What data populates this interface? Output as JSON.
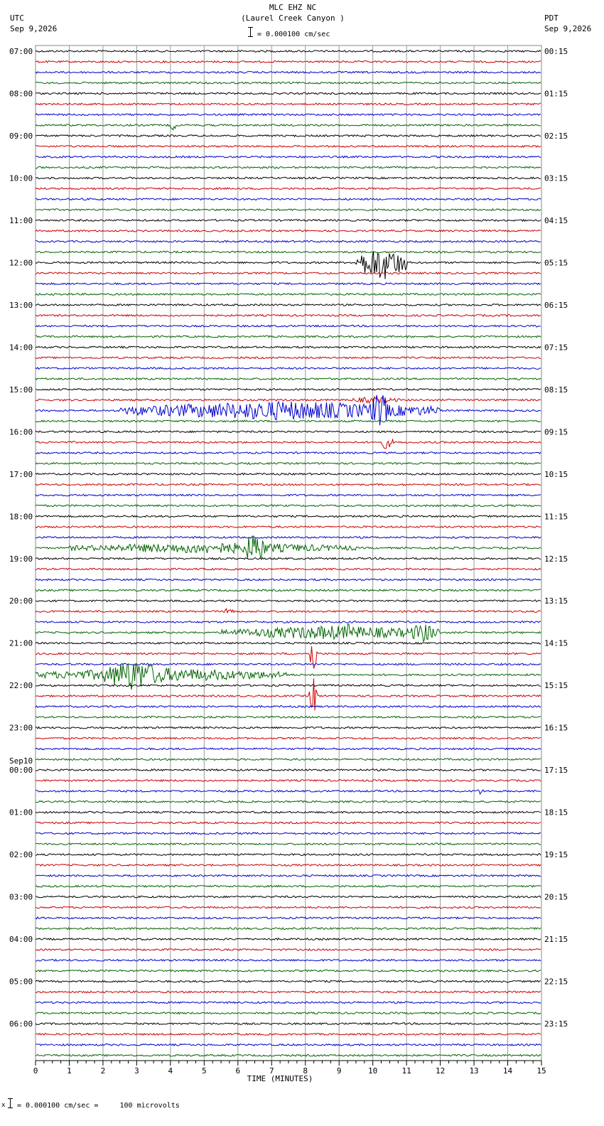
{
  "header": {
    "station": "MLC EHZ NC",
    "location": "(Laurel Creek Canyon )",
    "left_zone": "UTC",
    "left_date": "Sep 9,2026",
    "right_zone": "PDT",
    "right_date": "Sep 9,2026",
    "scale_text": "= 0.000100 cm/sec"
  },
  "footer": {
    "scale_text": "= 0.000100 cm/sec =     100 microvolts"
  },
  "chart_data": {
    "type": "line",
    "title": "MLC EHZ NC (Laurel Creek Canyon )",
    "xlabel": "TIME (MINUTES)",
    "xlim": [
      0,
      15
    ],
    "x_ticks": [
      "0",
      "1",
      "2",
      "3",
      "4",
      "5",
      "6",
      "7",
      "8",
      "9",
      "10",
      "11",
      "12",
      "13",
      "14",
      "15"
    ],
    "trace_colors": [
      "#000000",
      "#cc0000",
      "#0000cc",
      "#006400"
    ],
    "trace_count": 96,
    "traces_per_hour": 4,
    "minutes_per_trace": 15,
    "left_hour_labels": [
      "07:00",
      "08:00",
      "09:00",
      "10:00",
      "11:00",
      "12:00",
      "13:00",
      "14:00",
      "15:00",
      "16:00",
      "17:00",
      "18:00",
      "19:00",
      "20:00",
      "21:00",
      "22:00",
      "23:00",
      "00:00",
      "01:00",
      "02:00",
      "03:00",
      "04:00",
      "05:00",
      "06:00"
    ],
    "date_change": {
      "row_index": 17,
      "label": "Sep10"
    },
    "right_hour_labels": [
      "00:15",
      "01:15",
      "02:15",
      "03:15",
      "04:15",
      "05:15",
      "06:15",
      "07:15",
      "08:15",
      "09:15",
      "10:15",
      "11:15",
      "12:15",
      "13:15",
      "14:15",
      "15:15",
      "16:15",
      "17:15",
      "18:15",
      "19:15",
      "20:15",
      "21:15",
      "22:15",
      "23:15"
    ],
    "events": [
      {
        "trace": 7,
        "start_min": 4.0,
        "end_min": 4.15,
        "amp": 10
      },
      {
        "trace": 20,
        "start_min": 9.5,
        "end_min": 11.0,
        "amp": 26
      },
      {
        "trace": 34,
        "start_min": 2.5,
        "end_min": 12.0,
        "amp": 14
      },
      {
        "trace": 34,
        "start_min": 9.9,
        "end_min": 10.5,
        "amp": 28
      },
      {
        "trace": 33,
        "start_min": 9.3,
        "end_min": 10.8,
        "amp": 5
      },
      {
        "trace": 37,
        "start_min": 10.2,
        "end_min": 10.6,
        "amp": 10
      },
      {
        "trace": 47,
        "start_min": 1.0,
        "end_min": 9.5,
        "amp": 8
      },
      {
        "trace": 47,
        "start_min": 6.2,
        "end_min": 6.8,
        "amp": 26
      },
      {
        "trace": 53,
        "start_min": 5.6,
        "end_min": 5.9,
        "amp": 8
      },
      {
        "trace": 55,
        "start_min": 5.5,
        "end_min": 12.0,
        "amp": 10
      },
      {
        "trace": 55,
        "start_min": 11.0,
        "end_min": 12.0,
        "amp": 14
      },
      {
        "trace": 55,
        "start_min": 9.2,
        "end_min": 9.3,
        "amp": 28
      },
      {
        "trace": 57,
        "start_min": 8.1,
        "end_min": 8.35,
        "amp": 30
      },
      {
        "trace": 59,
        "start_min": 0.0,
        "end_min": 7.5,
        "amp": 10
      },
      {
        "trace": 59,
        "start_min": 2.0,
        "end_min": 3.8,
        "amp": 24
      },
      {
        "trace": 61,
        "start_min": 8.1,
        "end_min": 8.35,
        "amp": 30
      },
      {
        "trace": 70,
        "start_min": 13.0,
        "end_min": 13.3,
        "amp": 5
      }
    ]
  }
}
